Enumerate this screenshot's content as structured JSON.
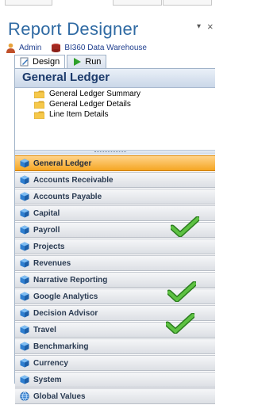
{
  "app": {
    "title": "Report Designer"
  },
  "user": {
    "name": "Admin",
    "database": "BI360 Data Warehouse"
  },
  "tabs": [
    {
      "label": "Design",
      "active": true
    },
    {
      "label": "Run",
      "active": false
    }
  ],
  "section": {
    "title": "General Ledger",
    "items": [
      {
        "label": "General Ledger Summary"
      },
      {
        "label": "General Ledger Details"
      },
      {
        "label": "Line Item Details"
      }
    ]
  },
  "nav": {
    "items": [
      {
        "label": "General Ledger",
        "active": true,
        "icon": "cube-icon",
        "checked": false
      },
      {
        "label": "Accounts Receivable",
        "active": false,
        "icon": "cube-icon",
        "checked": false
      },
      {
        "label": "Accounts Payable",
        "active": false,
        "icon": "cube-icon",
        "checked": false
      },
      {
        "label": "Capital",
        "active": false,
        "icon": "cube-icon",
        "checked": false
      },
      {
        "label": "Payroll",
        "active": false,
        "icon": "cube-icon",
        "checked": true
      },
      {
        "label": "Projects",
        "active": false,
        "icon": "cube-icon",
        "checked": false
      },
      {
        "label": "Revenues",
        "active": false,
        "icon": "cube-icon",
        "checked": false
      },
      {
        "label": "Narrative Reporting",
        "active": false,
        "icon": "cube-icon",
        "checked": false
      },
      {
        "label": "Google Analytics",
        "active": false,
        "icon": "cube-icon",
        "checked": true
      },
      {
        "label": "Decision Advisor",
        "active": false,
        "icon": "cube-icon",
        "checked": false
      },
      {
        "label": "Travel",
        "active": false,
        "icon": "cube-icon",
        "checked": true
      },
      {
        "label": "Benchmarking",
        "active": false,
        "icon": "cube-icon",
        "checked": false
      },
      {
        "label": "Currency",
        "active": false,
        "icon": "cube-icon",
        "checked": false
      },
      {
        "label": "System",
        "active": false,
        "icon": "cube-icon",
        "checked": false
      },
      {
        "label": "Global Values",
        "active": false,
        "icon": "globe-icon",
        "checked": false
      }
    ]
  },
  "colors": {
    "title": "#2f6aa3",
    "active_item": "#f5a623",
    "checkmark": "#3aa52a"
  }
}
